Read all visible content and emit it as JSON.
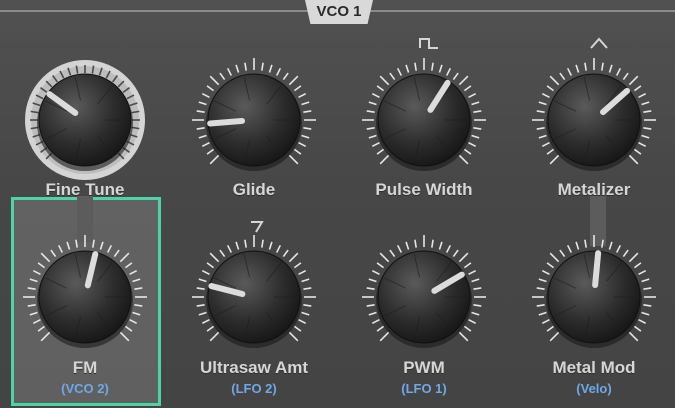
{
  "section": {
    "title": "VCO 1"
  },
  "accent": "#4fd1a9",
  "sub_label_color": "#6fa8e6",
  "knobs": [
    {
      "name": "Fine Tune",
      "sub": "",
      "value": 0.3,
      "wave_icon": ""
    },
    {
      "name": "Glide",
      "sub": "",
      "value": 0.15,
      "wave_icon": ""
    },
    {
      "name": "Pulse Width",
      "sub": "",
      "value": 0.62,
      "wave_icon": "square-wave-icon"
    },
    {
      "name": "Metalizer",
      "sub": "",
      "value": 0.68,
      "wave_icon": "triangle-wave-icon"
    },
    {
      "name": "FM",
      "sub": "(VCO 2)",
      "value": 0.55,
      "wave_icon": "",
      "selected": true
    },
    {
      "name": "Ultrasaw Amt",
      "sub": "(LFO 2)",
      "value": 0.22,
      "wave_icon": "saw-wave-icon"
    },
    {
      "name": "PWM",
      "sub": "(LFO 1)",
      "value": 0.72,
      "wave_icon": ""
    },
    {
      "name": "Metal Mod",
      "sub": "(Velo)",
      "value": 0.52,
      "wave_icon": ""
    }
  ]
}
